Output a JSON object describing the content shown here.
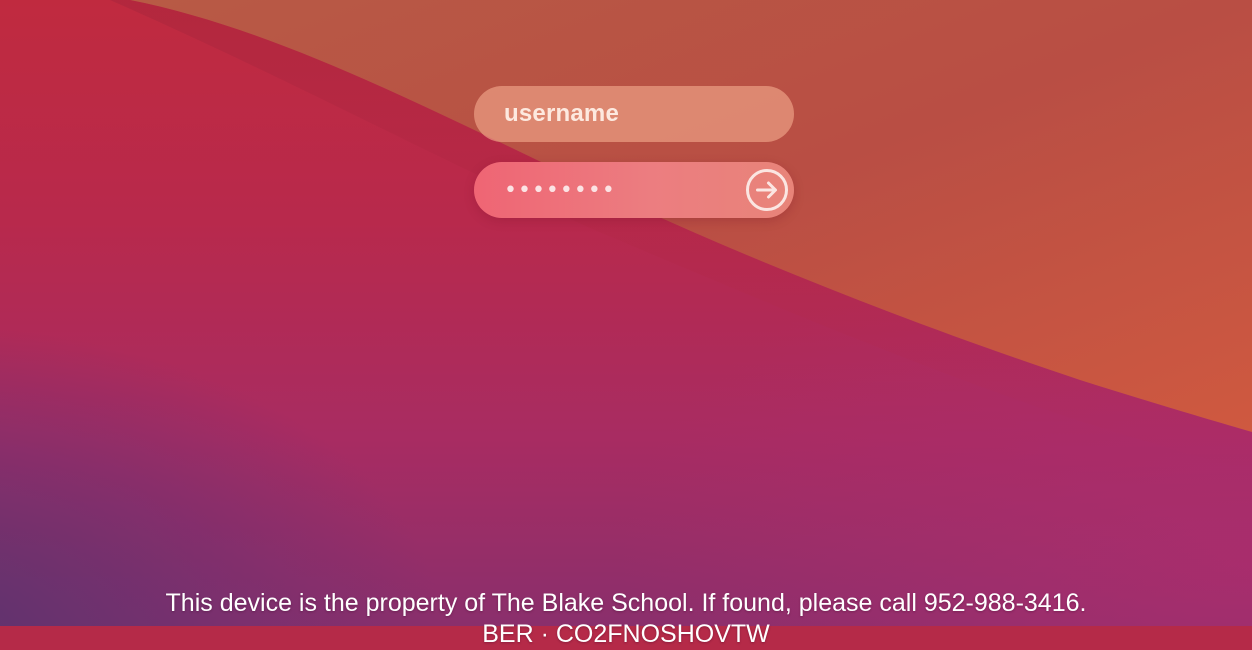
{
  "login": {
    "username_placeholder": "username",
    "password_masked": "••••••••",
    "submit_icon": "arrow-right-circle-icon"
  },
  "footer": {
    "ownership_notice": "This device is the property of The Blake School. If found, please call 952-988-3416.",
    "secondary_line": "BER · CO2FNOSHOVTW"
  },
  "colors": {
    "wallpaper_upper": "#c2603f",
    "wallpaper_middle": "#b8294c",
    "wallpaper_lower": "#8a2f6c",
    "username_field": "#e58d79",
    "password_field": "#ef6574",
    "text": "#ffffff"
  }
}
